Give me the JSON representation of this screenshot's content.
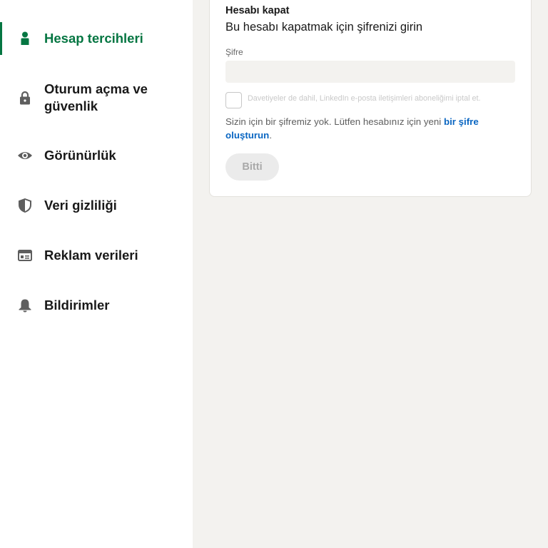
{
  "sidebar": {
    "items": [
      {
        "label": "Hesap tercihleri",
        "icon": "person-icon",
        "active": true
      },
      {
        "label": "Oturum açma ve güvenlik",
        "icon": "lock-icon",
        "active": false
      },
      {
        "label": "Görünürlük",
        "icon": "eye-icon",
        "active": false
      },
      {
        "label": "Veri gizliliği",
        "icon": "shield-icon",
        "active": false
      },
      {
        "label": "Reklam verileri",
        "icon": "ad-data-icon",
        "active": false
      },
      {
        "label": "Bildirimler",
        "icon": "bell-icon",
        "active": false
      }
    ]
  },
  "card": {
    "heading": "Hesabı kapat",
    "subheading": "Bu hesabı kapatmak için şifrenizi girin",
    "password_label": "Şifre",
    "password_value": "",
    "password_placeholder": "",
    "checkbox_label": "Davetiyeler de dahil, LinkedIn e-posta iletişimleri aboneliğimi iptal et.",
    "info_text": "Sizin için bir şifremiz yok. Lütfen hesabınız için yeni ",
    "info_link": "bir şifre oluşturun",
    "info_suffix": ".",
    "done_button": "Bitti"
  },
  "colors": {
    "accent": "#057642",
    "link": "#0a66c2",
    "background": "#f3f2ef"
  }
}
